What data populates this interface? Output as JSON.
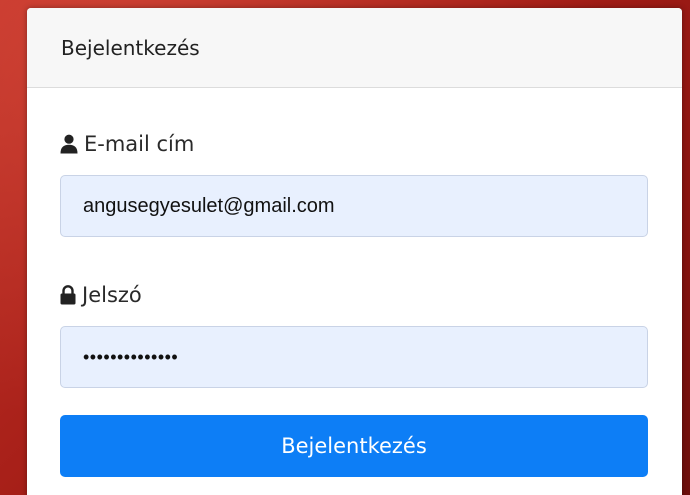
{
  "login": {
    "title": "Bejelentkezés",
    "email_label": "E-mail cím",
    "email_value": "angusegyesulet@gmail.com",
    "password_label": "Jelszó",
    "password_value": "••••••••••••••",
    "submit_label": "Bejelentkezés"
  },
  "icons": {
    "email_label_icon": "user-icon",
    "password_label_icon": "lock-icon"
  },
  "colors": {
    "primary_button": "#0d7ef6",
    "input_background": "#e8f0fe",
    "header_background": "#f7f7f7"
  }
}
